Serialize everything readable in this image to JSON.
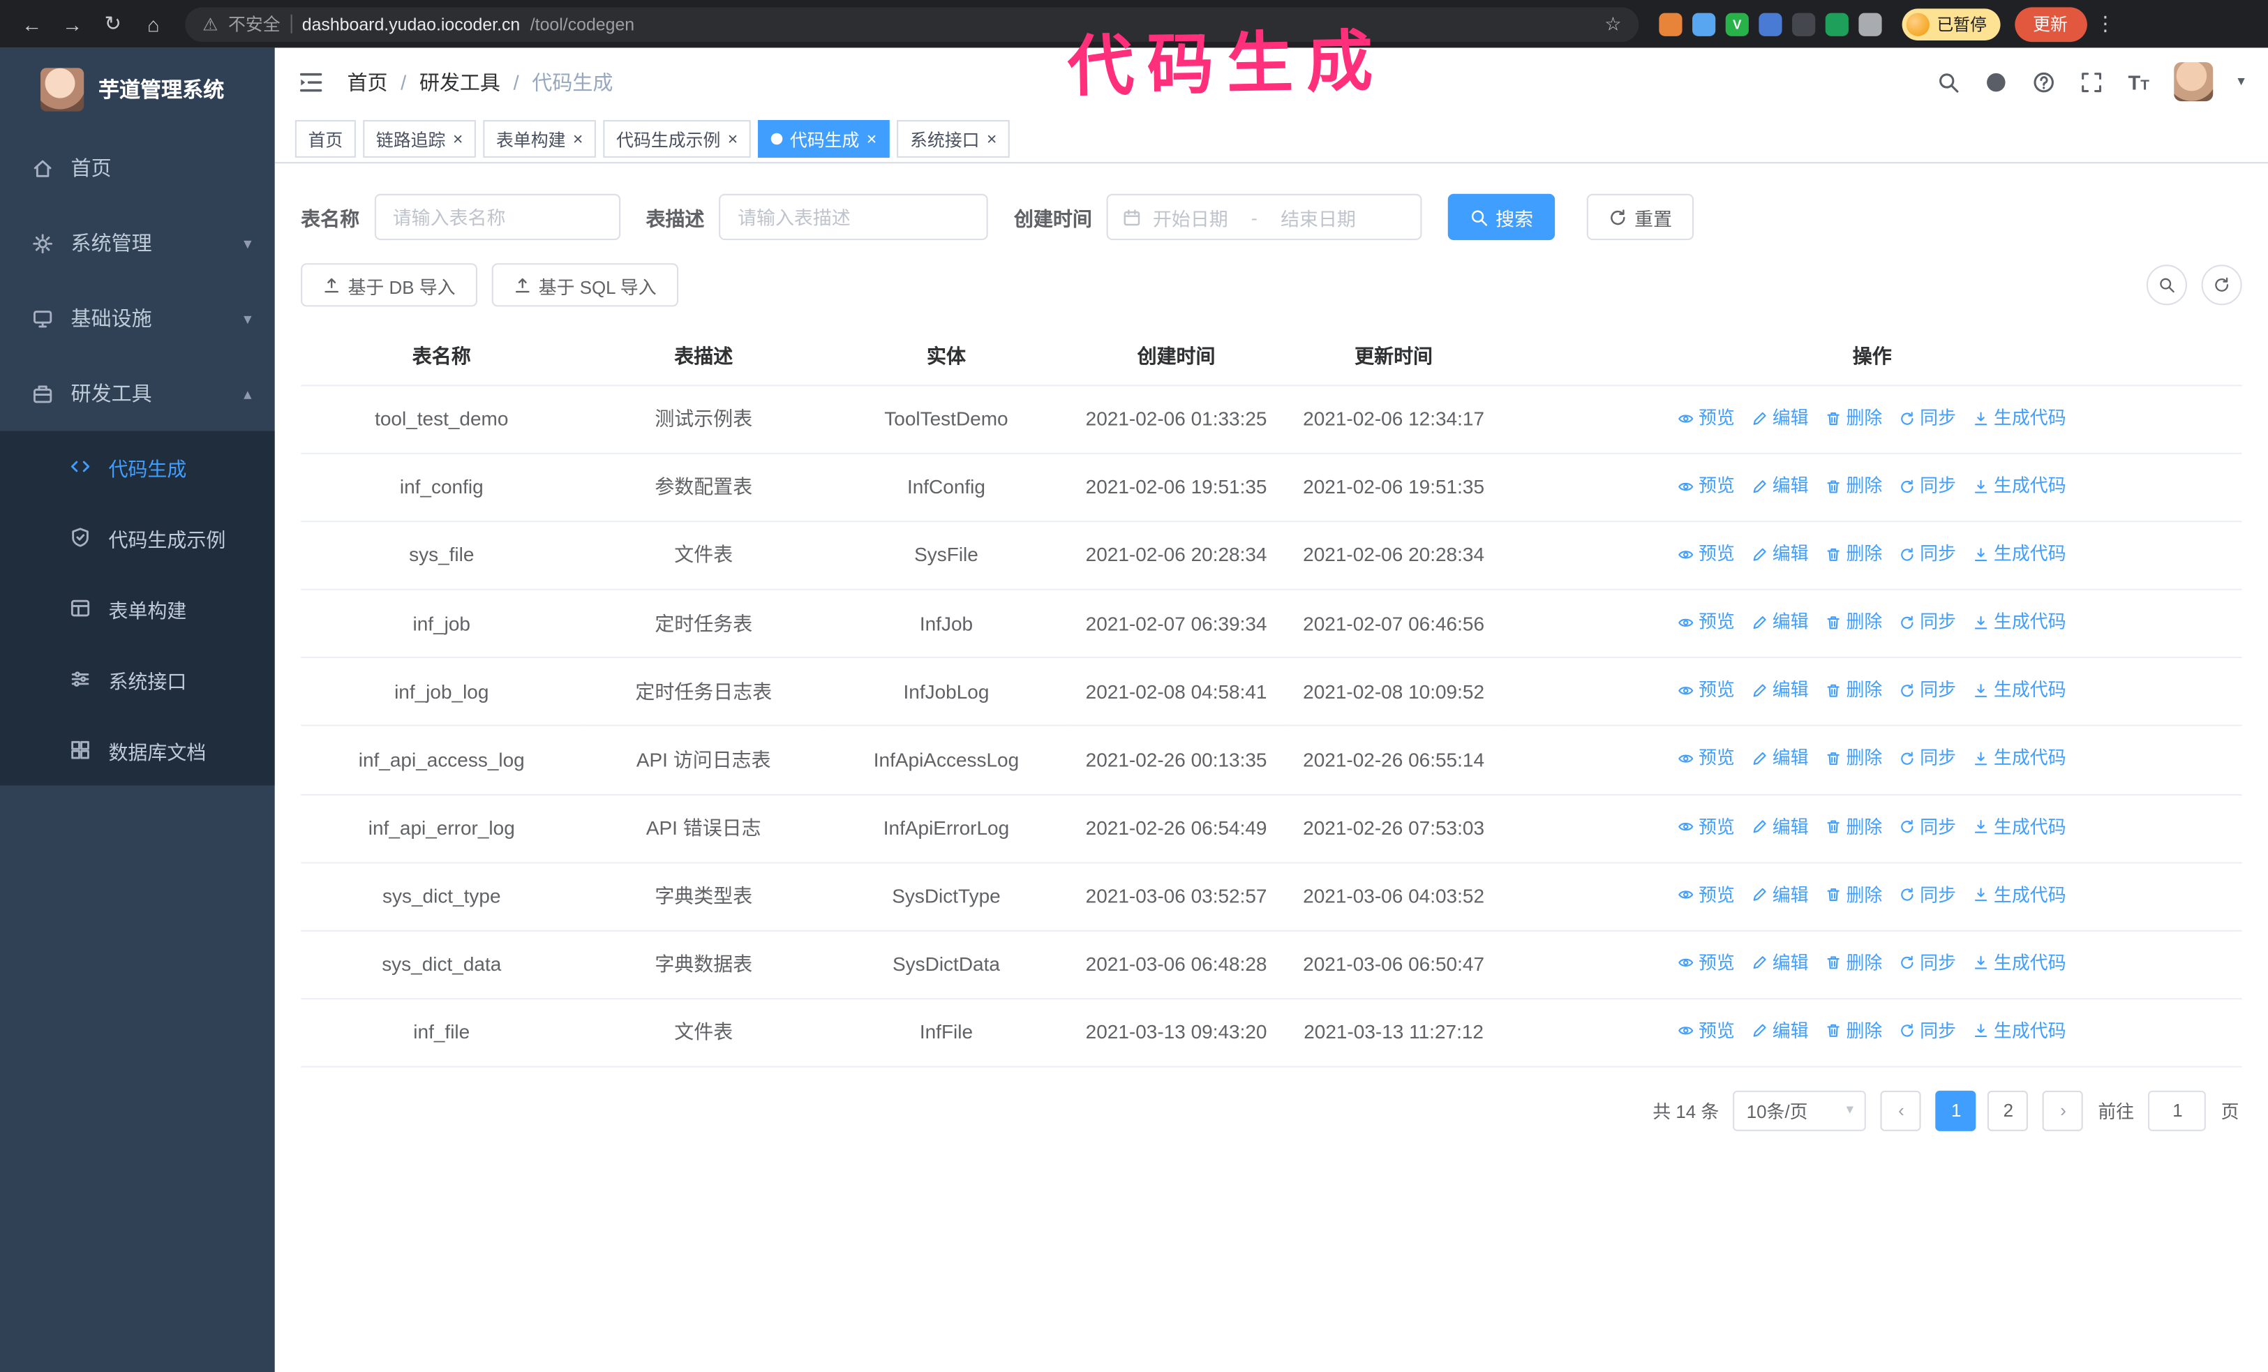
{
  "annotation": {
    "text": "代码生成",
    "color": "#ff2f7b"
  },
  "browser": {
    "insecure_label": "不安全",
    "url_domain": "dashboard.yudao.iocoder.cn",
    "url_path": "/tool/codegen",
    "paused_badge": "已暂停",
    "update_button": "更新",
    "extensions": [
      {
        "name": "ext-orange",
        "color": "#e8833a",
        "letter": ""
      },
      {
        "name": "ext-blue-drop",
        "color": "#58a6f0",
        "letter": ""
      },
      {
        "name": "ext-green-check",
        "color": "#27b24a",
        "letter": "V"
      },
      {
        "name": "ext-share",
        "color": "#4a7bd4",
        "letter": ""
      },
      {
        "name": "ext-capture",
        "color": "#44474d",
        "letter": ""
      },
      {
        "name": "ext-leaf",
        "color": "#1fa05a",
        "letter": ""
      },
      {
        "name": "ext-puzzle",
        "color": "#a8abb0",
        "letter": ""
      }
    ]
  },
  "sidebar": {
    "logo_title": "芋道管理系统",
    "menu": [
      {
        "label": "首页",
        "icon": "home",
        "chevron": ""
      },
      {
        "label": "系统管理",
        "icon": "gear",
        "chevron": "down"
      },
      {
        "label": "基础设施",
        "icon": "monitor",
        "chevron": "down"
      },
      {
        "label": "研发工具",
        "icon": "tool",
        "chevron": "up",
        "expanded": true
      }
    ],
    "submenu": [
      {
        "label": "代码生成",
        "icon": "code",
        "active": true
      },
      {
        "label": "代码生成示例",
        "icon": "shield",
        "active": false
      },
      {
        "label": "表单构建",
        "icon": "form",
        "active": false
      },
      {
        "label": "系统接口",
        "icon": "sliders",
        "active": false
      },
      {
        "label": "数据库文档",
        "icon": "db",
        "active": false
      }
    ]
  },
  "header": {
    "breadcrumb": [
      "首页",
      "研发工具",
      "代码生成"
    ]
  },
  "tabs": [
    {
      "label": "首页",
      "closable": false,
      "active": false
    },
    {
      "label": "链路追踪",
      "closable": true,
      "active": false
    },
    {
      "label": "表单构建",
      "closable": true,
      "active": false
    },
    {
      "label": "代码生成示例",
      "closable": true,
      "active": false
    },
    {
      "label": "代码生成",
      "closable": true,
      "active": true
    },
    {
      "label": "系统接口",
      "closable": true,
      "active": false
    }
  ],
  "filters": {
    "table_name_label": "表名称",
    "table_name_placeholder": "请输入表名称",
    "table_desc_label": "表描述",
    "table_desc_placeholder": "请输入表描述",
    "create_time_label": "创建时间",
    "start_date_placeholder": "开始日期",
    "range_separator": "-",
    "end_date_placeholder": "结束日期",
    "search_button": "搜索",
    "reset_button": "重置"
  },
  "toolbar": {
    "import_db": "基于 DB 导入",
    "import_sql": "基于 SQL 导入"
  },
  "table": {
    "columns": [
      "表名称",
      "表描述",
      "实体",
      "创建时间",
      "更新时间",
      "操作"
    ],
    "actions": [
      "预览",
      "编辑",
      "删除",
      "同步",
      "生成代码"
    ],
    "rows": [
      {
        "name": "tool_test_demo",
        "desc": "测试示例表",
        "entity": "ToolTestDemo",
        "created": "2021-02-06 01:33:25",
        "updated": "2021-02-06 12:34:17"
      },
      {
        "name": "inf_config",
        "desc": "参数配置表",
        "entity": "InfConfig",
        "created": "2021-02-06 19:51:35",
        "updated": "2021-02-06 19:51:35"
      },
      {
        "name": "sys_file",
        "desc": "文件表",
        "entity": "SysFile",
        "created": "2021-02-06 20:28:34",
        "updated": "2021-02-06 20:28:34"
      },
      {
        "name": "inf_job",
        "desc": "定时任务表",
        "entity": "InfJob",
        "created": "2021-02-07 06:39:34",
        "updated": "2021-02-07 06:46:56"
      },
      {
        "name": "inf_job_log",
        "desc": "定时任务日志表",
        "entity": "InfJobLog",
        "created": "2021-02-08 04:58:41",
        "updated": "2021-02-08 10:09:52"
      },
      {
        "name": "inf_api_access_log",
        "desc": "API 访问日志表",
        "entity": "InfApiAccessLog",
        "created": "2021-02-26 00:13:35",
        "updated": "2021-02-26 06:55:14"
      },
      {
        "name": "inf_api_error_log",
        "desc": "API 错误日志",
        "entity": "InfApiErrorLog",
        "created": "2021-02-26 06:54:49",
        "updated": "2021-02-26 07:53:03"
      },
      {
        "name": "sys_dict_type",
        "desc": "字典类型表",
        "entity": "SysDictType",
        "created": "2021-03-06 03:52:57",
        "updated": "2021-03-06 04:03:52"
      },
      {
        "name": "sys_dict_data",
        "desc": "字典数据表",
        "entity": "SysDictData",
        "created": "2021-03-06 06:48:28",
        "updated": "2021-03-06 06:50:47"
      },
      {
        "name": "inf_file",
        "desc": "文件表",
        "entity": "InfFile",
        "created": "2021-03-13 09:43:20",
        "updated": "2021-03-13 11:27:12"
      }
    ]
  },
  "pagination": {
    "total_text": "共 14 条",
    "page_size": "10条/页",
    "pages": [
      "1",
      "2"
    ],
    "active_page": "1",
    "prev": "‹",
    "next": "›",
    "goto_label": "前往",
    "goto_value": "1",
    "page_unit": "页"
  },
  "theme": {
    "primary": "#409eff",
    "sidebar_bg": "#304156",
    "submenu_bg": "#1f2d3d",
    "annotation": "#ff2f7b"
  }
}
